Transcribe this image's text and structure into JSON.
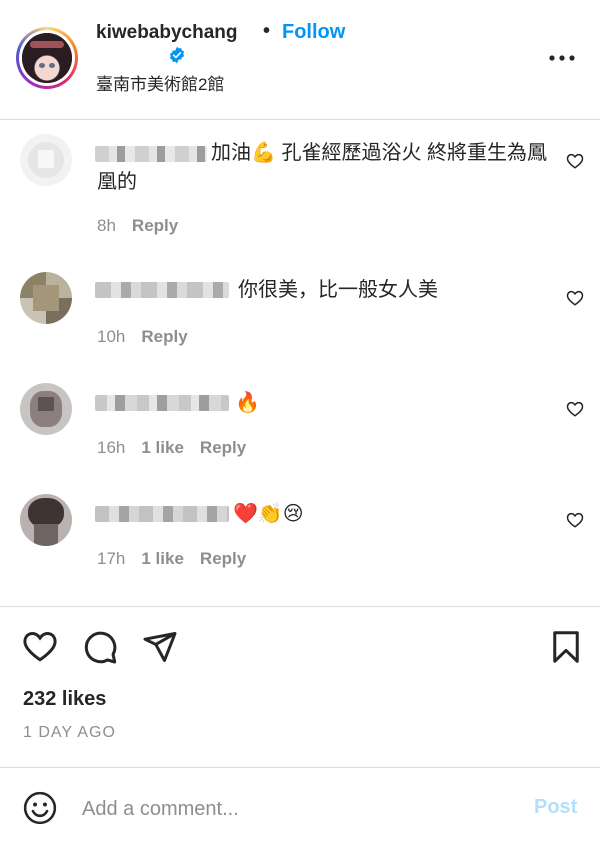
{
  "header": {
    "username": "kiwebabychang",
    "separator": "•",
    "follow_label": "Follow",
    "location": "臺南市美術館2館",
    "verified_icon": "verified-badge-icon",
    "more_icon": "more-options-icon"
  },
  "comments": [
    {
      "text": "加油💪 孔雀經歷過浴火 終將重生為鳳凰的",
      "time": "8h",
      "likes": "",
      "reply_label": "Reply"
    },
    {
      "text": "你很美，比一般女人美",
      "time": "10h",
      "likes": "",
      "reply_label": "Reply"
    },
    {
      "text": "🔥",
      "time": "16h",
      "likes": "1 like",
      "reply_label": "Reply"
    },
    {
      "text": "❤️👏😢",
      "time": "17h",
      "likes": "1 like",
      "reply_label": "Reply"
    }
  ],
  "footer": {
    "likes": "232 likes",
    "posted": "1 DAY AGO",
    "add_comment_placeholder": "Add a comment...",
    "post_label": "Post"
  },
  "colors": {
    "accent": "#0095f6",
    "post_disabled": "#b2dffc",
    "secondary_text": "#8e8e8e",
    "divider": "#dbdbdb"
  }
}
